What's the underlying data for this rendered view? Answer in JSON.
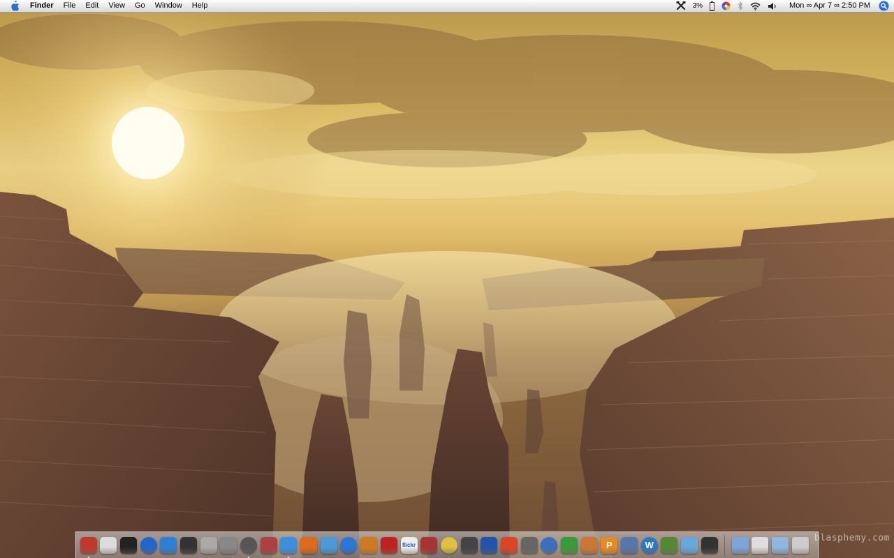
{
  "menubar": {
    "app_name": "Finder",
    "menus": [
      "File",
      "Edit",
      "View",
      "Go",
      "Window",
      "Help"
    ],
    "status": {
      "battery_percent": "3%",
      "clock": "Mon ∞ Apr 7 ∞ 2:50 PM"
    },
    "icons": [
      "apple-icon",
      "tools-icon",
      "battery-icon",
      "color-wheel-icon",
      "bluetooth-icon",
      "wifi-icon",
      "volume-icon",
      "spotlight-icon"
    ]
  },
  "desktop": {
    "wallpaper": "canyon-sunset",
    "watermark": "blasphemy.com"
  },
  "colors": {
    "menubar_bg": "#e9e9e9",
    "spotlight_blue": "#2a6fd6",
    "sky": "#ecd58a",
    "rock": "#6d4c34"
  },
  "dock": {
    "apps": [
      {
        "name": "finder",
        "running": true,
        "color": "#c0392b",
        "label": ""
      },
      {
        "name": "system-profiler",
        "running": false,
        "color": "#dcdcdc",
        "label": ""
      },
      {
        "name": "terminal",
        "running": false,
        "color": "#222222",
        "label": ""
      },
      {
        "name": "app-3",
        "running": false,
        "color": "#2266cc",
        "label": ""
      },
      {
        "name": "network",
        "running": false,
        "color": "#2f7fd6",
        "label": ""
      },
      {
        "name": "activity-monitor",
        "running": false,
        "color": "#333333",
        "label": ""
      },
      {
        "name": "app-6",
        "running": false,
        "color": "#aaaaaa",
        "label": ""
      },
      {
        "name": "app-7",
        "running": false,
        "color": "#888888",
        "label": ""
      },
      {
        "name": "dvd-player",
        "running": true,
        "color": "#555555",
        "label": ""
      },
      {
        "name": "address-book",
        "running": false,
        "color": "#b04040",
        "label": ""
      },
      {
        "name": "safari",
        "running": true,
        "color": "#3a8fe0",
        "label": ""
      },
      {
        "name": "firefox",
        "running": false,
        "color": "#e06a1a",
        "label": ""
      },
      {
        "name": "itunes",
        "running": false,
        "color": "#4a9ad8",
        "label": ""
      },
      {
        "name": "quicktime",
        "running": false,
        "color": "#2a78d6",
        "label": ""
      },
      {
        "name": "iphoto",
        "running": false,
        "color": "#d07a20",
        "label": ""
      },
      {
        "name": "photo-booth",
        "running": false,
        "color": "#c02020",
        "label": ""
      },
      {
        "name": "flickr-uploader",
        "running": false,
        "color": "#eeeeee",
        "label": "flickr"
      },
      {
        "name": "app-17",
        "running": false,
        "color": "#aa3333",
        "label": ""
      },
      {
        "name": "app-18",
        "running": false,
        "color": "#e0c040",
        "label": ""
      },
      {
        "name": "app-19",
        "running": false,
        "color": "#444444",
        "label": ""
      },
      {
        "name": "app-20",
        "running": false,
        "color": "#2255aa",
        "label": ""
      },
      {
        "name": "app-21",
        "running": false,
        "color": "#dd4422",
        "label": ""
      },
      {
        "name": "app-22",
        "running": false,
        "color": "#666666",
        "label": ""
      },
      {
        "name": "app-23",
        "running": false,
        "color": "#3a6fc0",
        "label": ""
      },
      {
        "name": "app-24",
        "running": false,
        "color": "#3a9a3a",
        "label": ""
      },
      {
        "name": "app-25",
        "running": false,
        "color": "#cc7733",
        "label": ""
      },
      {
        "name": "app-26",
        "running": false,
        "color": "#e88a20",
        "label": "P"
      },
      {
        "name": "app-27",
        "running": false,
        "color": "#5577aa",
        "label": ""
      },
      {
        "name": "app-28",
        "running": false,
        "color": "#2a78c8",
        "label": "W"
      },
      {
        "name": "app-29",
        "running": false,
        "color": "#558833",
        "label": ""
      },
      {
        "name": "app-30",
        "running": false,
        "color": "#66aadd",
        "label": ""
      },
      {
        "name": "app-31",
        "running": false,
        "color": "#333333",
        "label": ""
      }
    ],
    "stacks": [
      {
        "name": "documents-stack",
        "color": "#7aa6d8"
      },
      {
        "name": "applications-stack",
        "color": "#dddddd"
      },
      {
        "name": "downloads-stack",
        "color": "#8fb8e0"
      },
      {
        "name": "trash",
        "color": "#cccccc"
      }
    ]
  }
}
